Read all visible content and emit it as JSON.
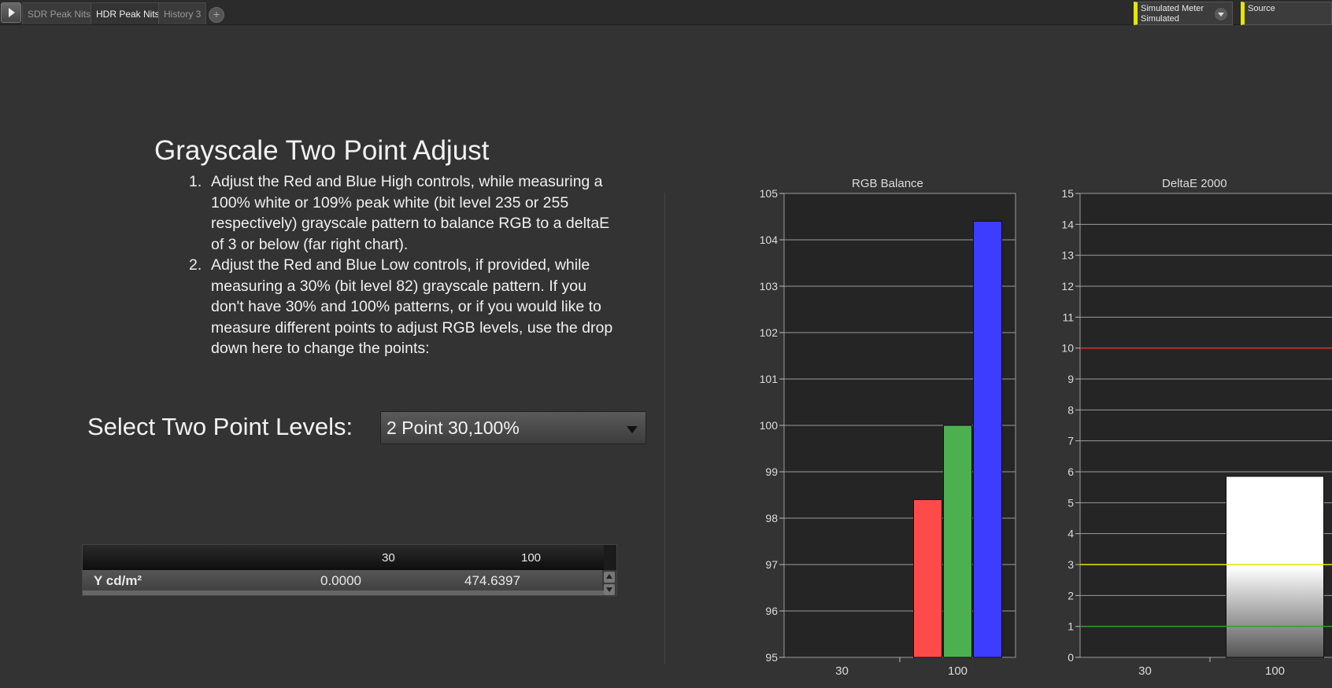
{
  "tabs": [
    {
      "label": "SDR Peak Nits",
      "active": false
    },
    {
      "label": "HDR Peak Nits",
      "active": true
    },
    {
      "label": "History 3",
      "active": false
    }
  ],
  "add_tab_label": "+",
  "meter": {
    "line1": "Simulated Meter",
    "line2": "Simulated"
  },
  "source": {
    "label": "Source"
  },
  "instructions": {
    "title": "Grayscale Two Point Adjust",
    "steps": [
      {
        "num": "1.",
        "text": "Adjust the Red and Blue High controls, while measuring a 100% white or 109% peak white (bit level 235 or 255 respectively) grayscale pattern to balance RGB to a deltaE of 3 or below (far right chart)."
      },
      {
        "num": "2.",
        "text": "Adjust the Red and Blue Low controls, if provided, while measuring a 30% (bit level 82) grayscale pattern. If you don't have 30% and 100% patterns, or if you would like to measure different points to adjust RGB levels, use the drop down here to change the points:"
      }
    ]
  },
  "select": {
    "label": "Select Two Point Levels:",
    "value": "2 Point 30,100%"
  },
  "table": {
    "columns": [
      "30",
      "100"
    ],
    "row_label": "Y cd/m²",
    "values": [
      "0.0000",
      "474.6397"
    ]
  },
  "chart_data": [
    {
      "type": "bar",
      "title": "RGB Balance",
      "categories": [
        "30",
        "100"
      ],
      "ylim": [
        95,
        105
      ],
      "yticks": [
        "95",
        "96",
        "97",
        "98",
        "99",
        "100",
        "101",
        "102",
        "103",
        "104",
        "105"
      ],
      "grid": true,
      "series": [
        {
          "color": "#ff4a4a",
          "values": [
            null,
            98.4
          ]
        },
        {
          "color": "#4caf50",
          "values": [
            null,
            100.0
          ]
        },
        {
          "color": "#3d3dff",
          "values": [
            null,
            104.4
          ]
        }
      ]
    },
    {
      "type": "bar",
      "title": "DeltaE 2000",
      "categories": [
        "30",
        "100"
      ],
      "ylim": [
        0,
        15
      ],
      "yticks": [
        "0",
        "1",
        "2",
        "3",
        "4",
        "5",
        "6",
        "7",
        "8",
        "9",
        "10",
        "11",
        "12",
        "13",
        "14",
        "15"
      ],
      "grid": true,
      "values": [
        null,
        5.85
      ],
      "bar_color": "#ffffff",
      "thresholds": [
        {
          "value": 10,
          "color": "#d93030"
        },
        {
          "value": 3,
          "color": "#e6e600"
        },
        {
          "value": 1,
          "color": "#2e9c2e"
        }
      ]
    }
  ]
}
